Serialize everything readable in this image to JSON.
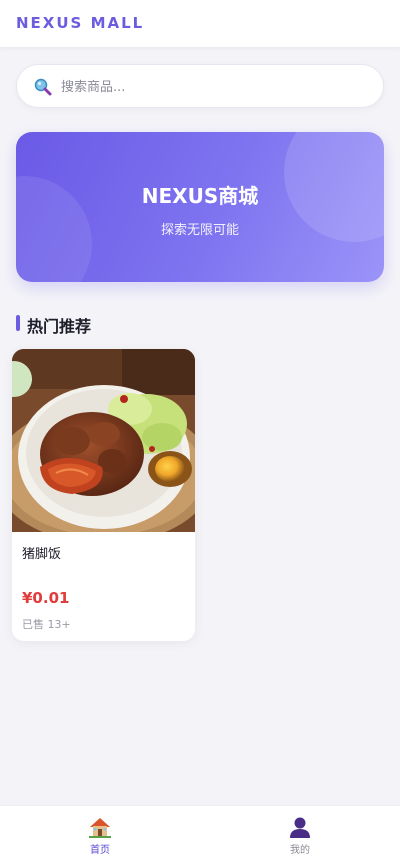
{
  "header": {
    "brand": "NEXUS MALL"
  },
  "search": {
    "placeholder": "搜索商品..."
  },
  "banner": {
    "title": "NEXUS商城",
    "subtitle": "探索无限可能"
  },
  "section": {
    "title": "热门推荐"
  },
  "products": [
    {
      "name": "猪脚饭",
      "price": "¥0.01",
      "sold": "已售 13+"
    }
  ],
  "tabbar": {
    "items": [
      {
        "label": "首页",
        "icon": "home-icon",
        "active": true
      },
      {
        "label": "我的",
        "icon": "user-icon",
        "active": false
      }
    ]
  },
  "colors": {
    "accent": "#6b5ce0",
    "price": "#e23b3b",
    "background": "#f4f4f8"
  }
}
